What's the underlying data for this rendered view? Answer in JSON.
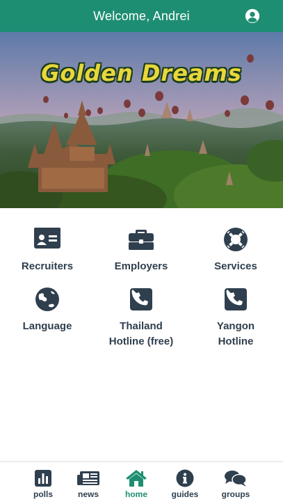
{
  "header": {
    "title": "Welcome, Andrei",
    "icon": "user-circle-icon"
  },
  "hero": {
    "logo_text": "Golden Dreams"
  },
  "tiles": [
    {
      "label": "Recruiters",
      "icon": "id-card-icon"
    },
    {
      "label": "Employers",
      "icon": "briefcase-icon"
    },
    {
      "label": "Services",
      "icon": "life-ring-icon"
    },
    {
      "label": "Language",
      "icon": "globe-icon"
    },
    {
      "label_line1": "Thailand",
      "label_line2": "Hotline (free)",
      "icon": "phone-square-icon"
    },
    {
      "label_line1": "Yangon",
      "label_line2": "Hotline",
      "icon": "phone-square-icon"
    }
  ],
  "bottom_nav": [
    {
      "label": "polls",
      "icon": "bar-chart-icon"
    },
    {
      "label": "news",
      "icon": "newspaper-icon"
    },
    {
      "label": "home",
      "icon": "home-icon",
      "active": true
    },
    {
      "label": "guides",
      "icon": "info-circle-icon"
    },
    {
      "label": "groups",
      "icon": "comments-icon"
    }
  ],
  "colors": {
    "primary": "#1e8e72",
    "icon_dark": "#2f3f4e",
    "logo": "#e8d73a"
  }
}
